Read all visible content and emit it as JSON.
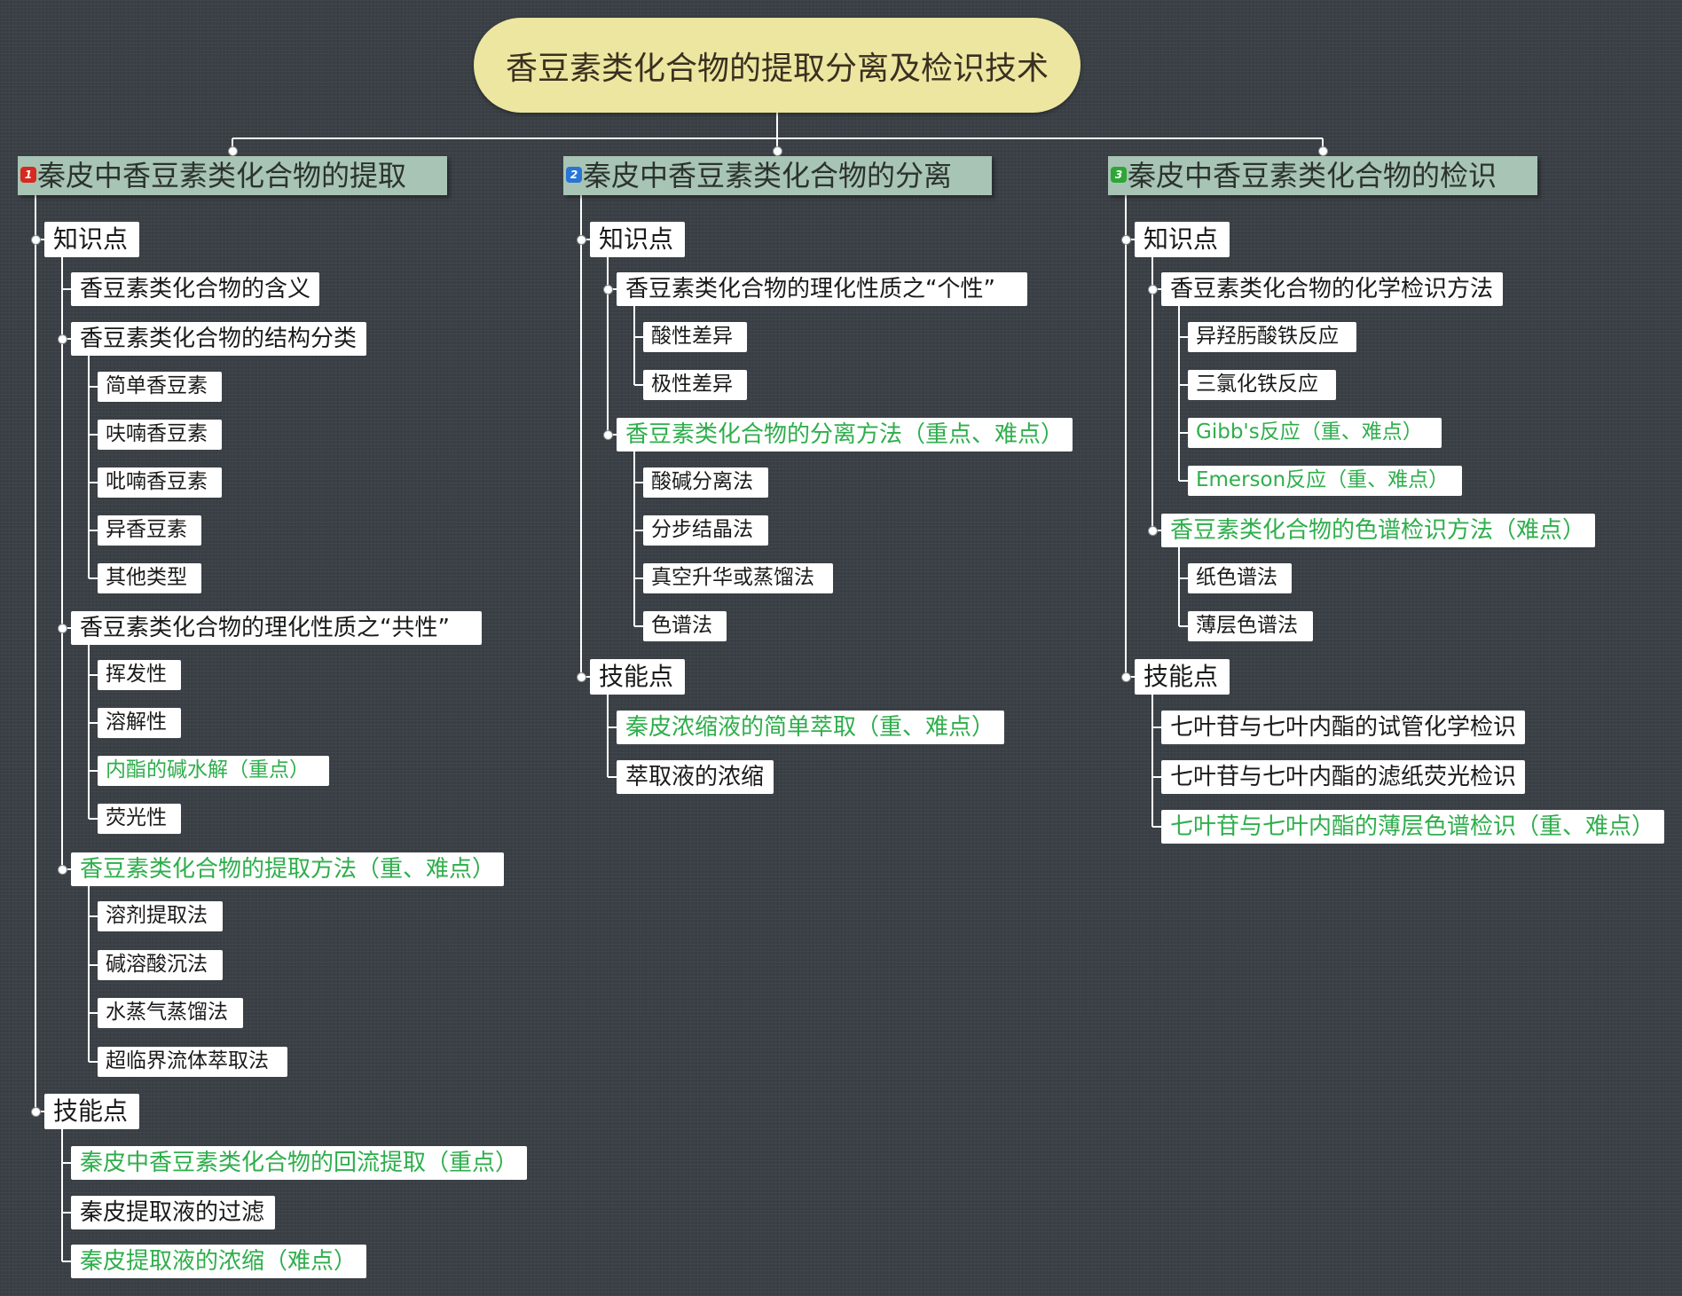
{
  "root": "香豆素类化合物的提取分离及检识技术",
  "branches": [
    {
      "badge": "1",
      "title": "秦皮中香豆素类化合物的提取",
      "knowledge": "知识点",
      "k_items": [
        {
          "text": "香豆素类化合物的含义"
        },
        {
          "text": "香豆素类化合物的结构分类",
          "children": [
            "简单香豆素",
            "呋喃香豆素",
            "吡喃香豆素",
            "异香豆素",
            "其他类型"
          ]
        },
        {
          "text": "香豆素类化合物的理化性质之“共性”",
          "children": [
            "挥发性",
            "溶解性",
            "内酯的碱水解（重点）",
            "荧光性"
          ]
        },
        {
          "text": "香豆素类化合物的提取方法（重、难点）",
          "children": [
            "溶剂提取法",
            "碱溶酸沉法",
            "水蒸气蒸馏法",
            "超临界流体萃取法"
          ]
        }
      ],
      "skills": "技能点",
      "s_items": [
        "秦皮中香豆素类化合物的回流提取（重点）",
        "秦皮提取液的过滤",
        "秦皮提取液的浓缩（难点）"
      ]
    },
    {
      "badge": "2",
      "title": "秦皮中香豆素类化合物的分离",
      "knowledge": "知识点",
      "k_items": [
        {
          "text": "香豆素类化合物的理化性质之“个性”",
          "children": [
            "酸性差异",
            "极性差异"
          ]
        },
        {
          "text": "香豆素类化合物的分离方法（重点、难点）",
          "children": [
            "酸碱分离法",
            "分步结晶法",
            "真空升华或蒸馏法",
            "色谱法"
          ]
        }
      ],
      "skills": "技能点",
      "s_items": [
        "秦皮浓缩液的简单萃取（重、难点）",
        "萃取液的浓缩"
      ]
    },
    {
      "badge": "3",
      "title": "秦皮中香豆素类化合物的检识",
      "knowledge": "知识点",
      "k_items": [
        {
          "text": "香豆素类化合物的化学检识方法",
          "children": [
            "异羟肟酸铁反应",
            "三氯化铁反应",
            "Gibb's反应（重、难点）",
            "Emerson反应（重、难点）"
          ]
        },
        {
          "text": "香豆素类化合物的色谱检识方法（难点）",
          "children": [
            "纸色谱法",
            "薄层色谱法"
          ]
        }
      ],
      "skills": "技能点",
      "s_items": [
        "七叶苷与七叶内酯的试管化学检识",
        "七叶苷与七叶内酯的滤纸荧光检识",
        "七叶苷与七叶内酯的薄层色谱检识（重、难点）"
      ]
    }
  ],
  "colors": {
    "background": "#3a4045",
    "root_fill": "#ece6a0",
    "branch_fill": "#a8c4b4",
    "highlight_text": "#2fae4c",
    "line": "#ffffff"
  }
}
